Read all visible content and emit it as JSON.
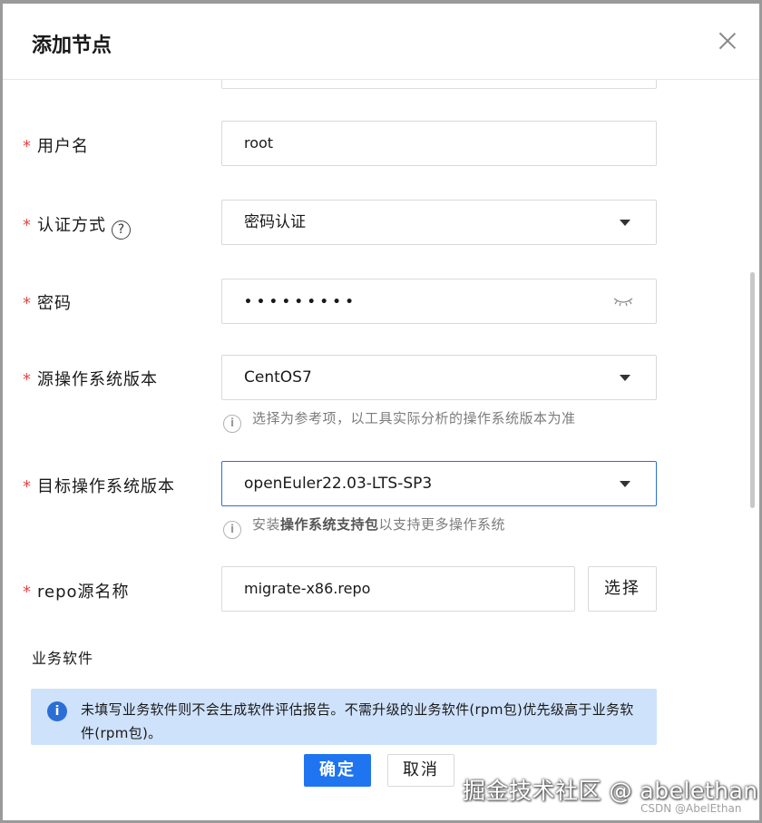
{
  "dialog": {
    "title": "添加节点"
  },
  "form": {
    "username": {
      "label": "用户名",
      "value": "root"
    },
    "auth_method": {
      "label": "认证方式",
      "value": "密码认证",
      "help": "?"
    },
    "password": {
      "label": "密码",
      "masked_value": "•••••••••"
    },
    "source_os": {
      "label": "源操作系统版本",
      "value": "CentOS7",
      "hint": "选择为参考项，以工具实际分析的操作系统版本为准"
    },
    "target_os": {
      "label": "目标操作系统版本",
      "value": "openEuler22.03-LTS-SP3",
      "hint_prefix": "安装",
      "hint_link": "操作系统支持包",
      "hint_suffix": "以支持更多操作系统"
    },
    "repo": {
      "label": "repo源名称",
      "value": "migrate-x86.repo",
      "select_label": "选择"
    }
  },
  "business_software": {
    "title": "业务软件",
    "notice": "未填写业务软件则不会生成软件评估报告。不需升级的业务软件(rpm包)优先级高于业务软件(rpm包)。",
    "notice_icon": "i"
  },
  "footer": {
    "confirm_label": "确定",
    "cancel_label": "取消"
  },
  "watermark": {
    "main": "掘金技术社区 @ abelethan",
    "sub": "CSDN @AbelEthan"
  },
  "icons": {
    "info": "i",
    "required": "*"
  },
  "colors": {
    "primary": "#1f75f0",
    "required": "#e54545",
    "notice_bg": "#cfe2fc"
  }
}
